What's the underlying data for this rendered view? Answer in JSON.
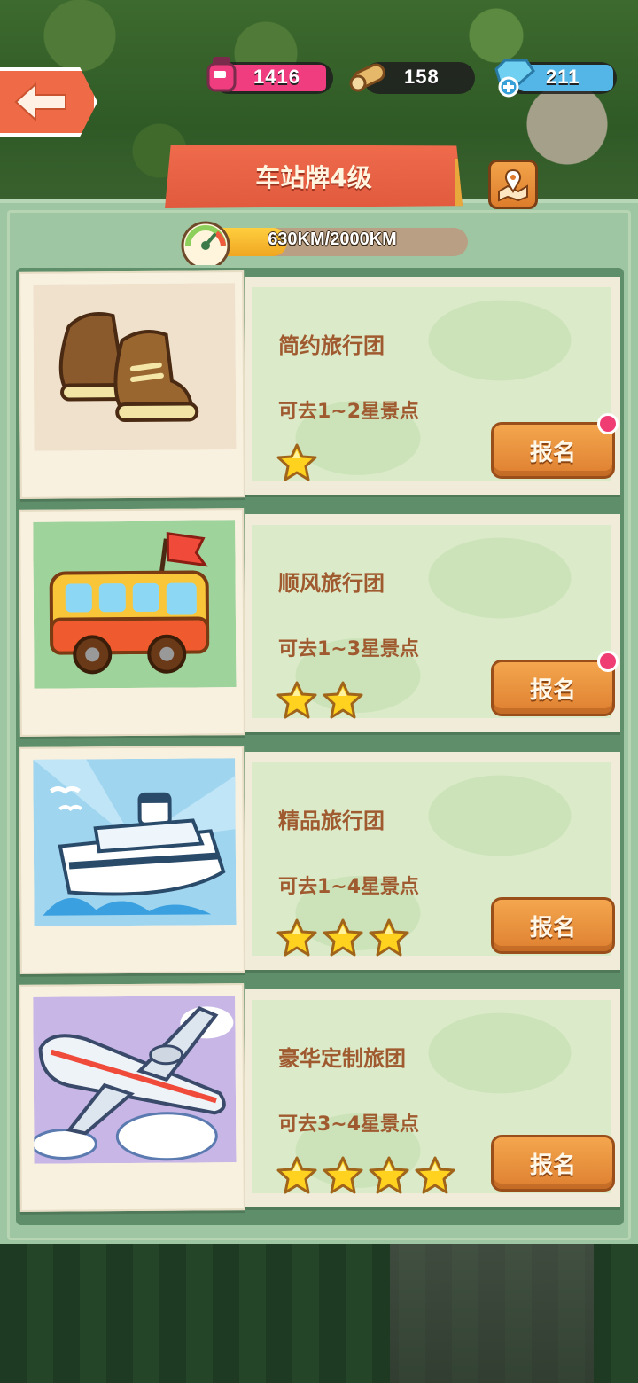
{
  "resources": {
    "ink": "1416",
    "wood": "158",
    "gems": "211"
  },
  "header": {
    "title": "车站牌4级"
  },
  "progress": {
    "label": "630KM/2000KM",
    "fraction": 0.315
  },
  "cards": [
    {
      "name": "简约旅行团",
      "desc": "可去1~2星景点",
      "stars": 1,
      "button": "报名",
      "badge": true,
      "image": "boots-icon"
    },
    {
      "name": "顺风旅行团",
      "desc": "可去1~3星景点",
      "stars": 2,
      "button": "报名",
      "badge": true,
      "image": "bus-icon"
    },
    {
      "name": "精品旅行团",
      "desc": "可去1~4星景点",
      "stars": 3,
      "button": "报名",
      "badge": false,
      "image": "ship-icon"
    },
    {
      "name": "豪华定制旅团",
      "desc": "可去3~4星景点",
      "stars": 4,
      "button": "报名",
      "badge": false,
      "image": "airplane-icon"
    }
  ],
  "colors": {
    "accent": "#ef6a47",
    "button": "#e58c36",
    "text": "#a05a30",
    "panel": "#9fc6a2",
    "badge": "#ef3d74"
  },
  "icons": [
    "back-arrow-icon",
    "ink-bottle-icon",
    "wood-log-icon",
    "gem-icon",
    "map-pin-icon",
    "speed-gauge-icon",
    "star-icon"
  ]
}
